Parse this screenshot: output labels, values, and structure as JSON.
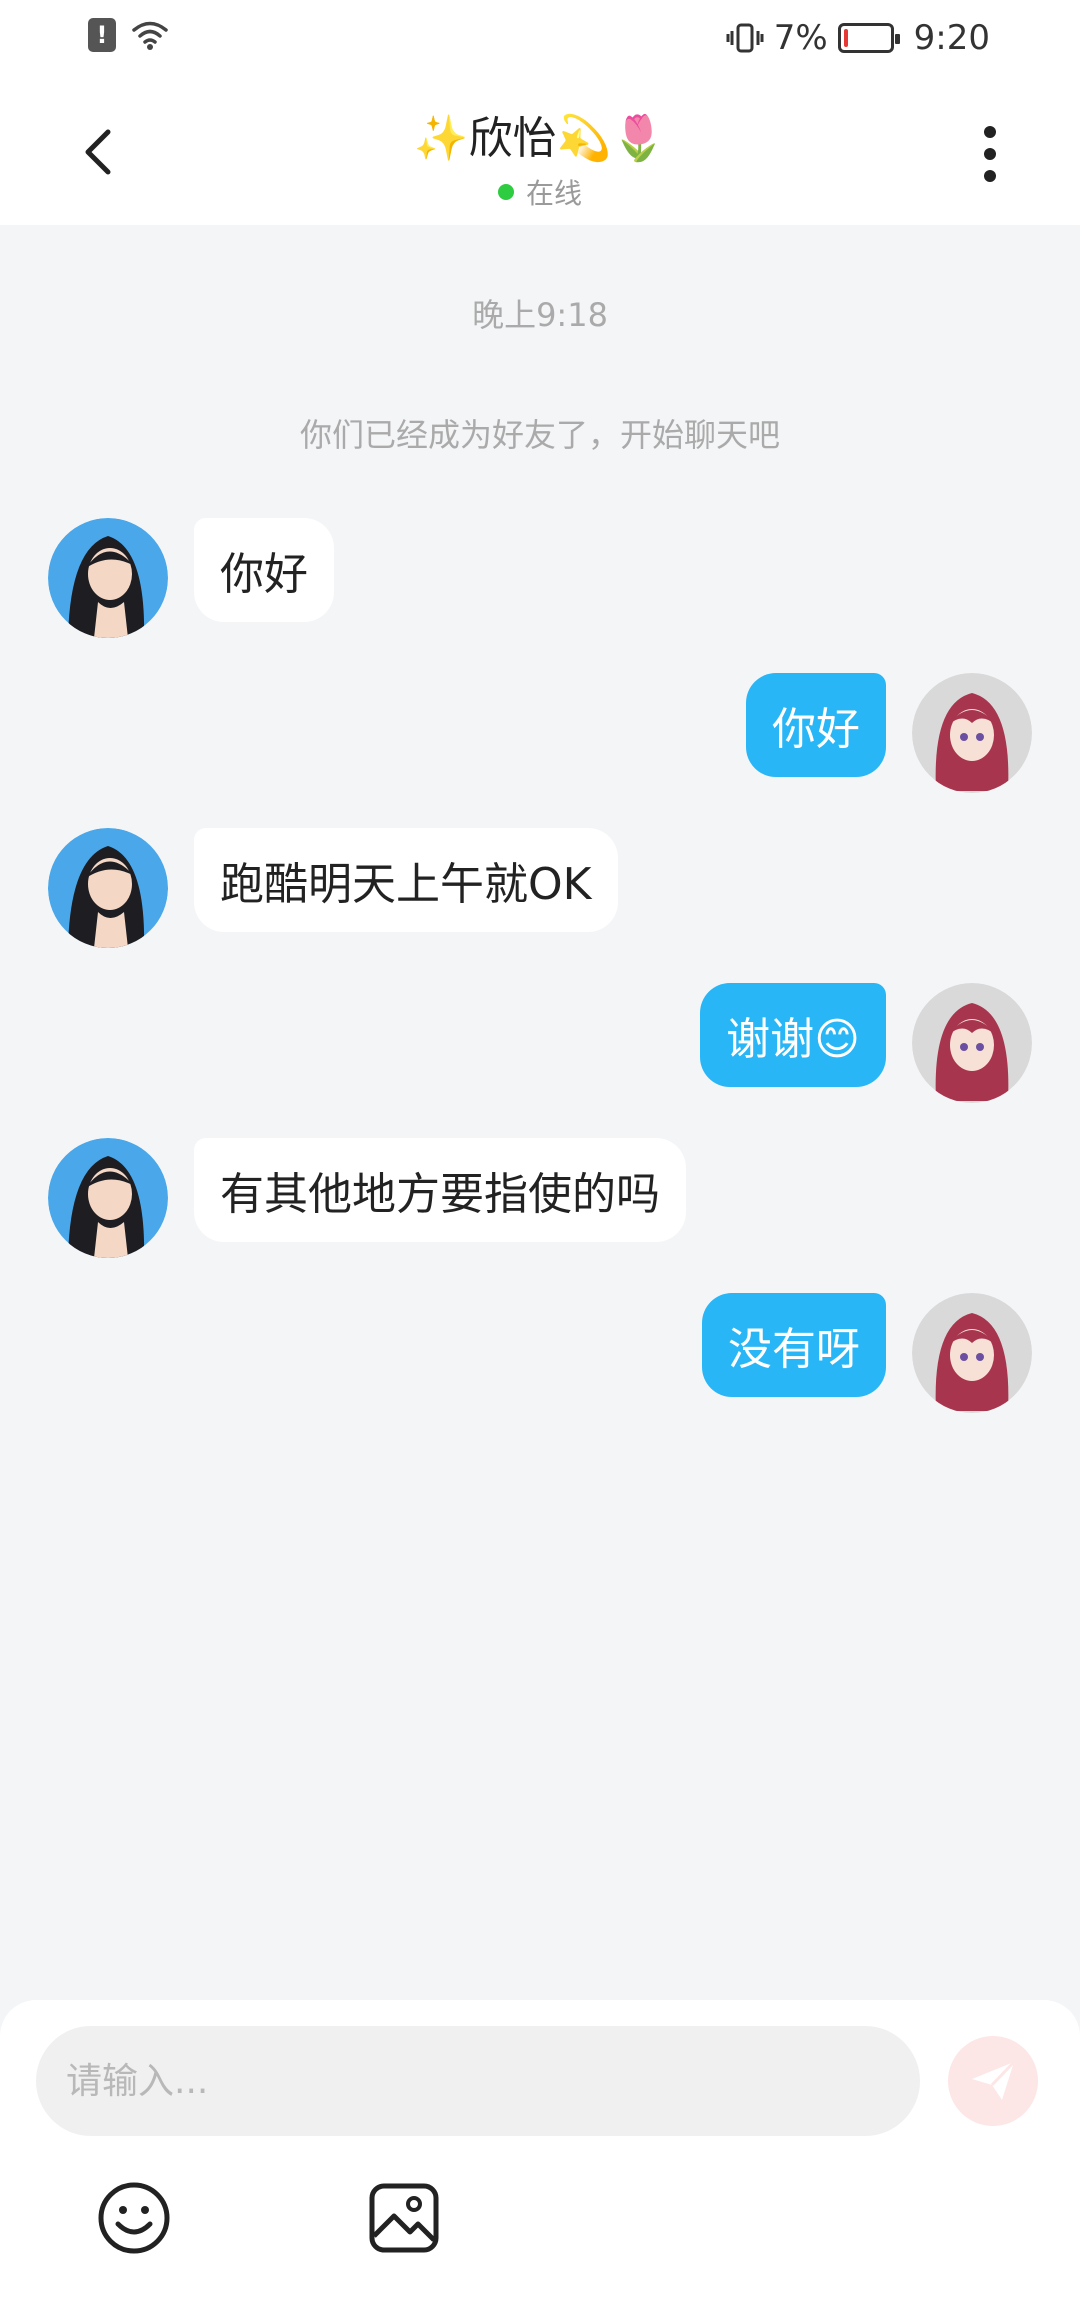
{
  "status_bar": {
    "battery_percent": "7%",
    "battery_level": 0.07,
    "time": "9:20"
  },
  "header": {
    "title": "✨欣怡💫🌷",
    "status": "在线",
    "online_color": "#2ecc40"
  },
  "chat": {
    "time_label": "晚上9:18",
    "system_message": "你们已经成为好友了，开始聊天吧",
    "messages": [
      {
        "side": "left",
        "text": "你好"
      },
      {
        "side": "right",
        "text": "你好"
      },
      {
        "side": "left",
        "text": "跑酷明天上午就OK"
      },
      {
        "side": "right",
        "text": "谢谢😊"
      },
      {
        "side": "left",
        "text": "有其他地方要指使的吗"
      },
      {
        "side": "right",
        "text": "没有呀"
      }
    ]
  },
  "input": {
    "placeholder": "请输入..."
  },
  "icons": {
    "back": "back-arrow-icon",
    "more": "more-vertical-icon",
    "send": "send-icon",
    "emoji": "emoji-icon",
    "image": "image-icon"
  },
  "colors": {
    "accent": "#29b6f6",
    "background": "#f4f5f7",
    "send_button": "#fde6e6"
  }
}
